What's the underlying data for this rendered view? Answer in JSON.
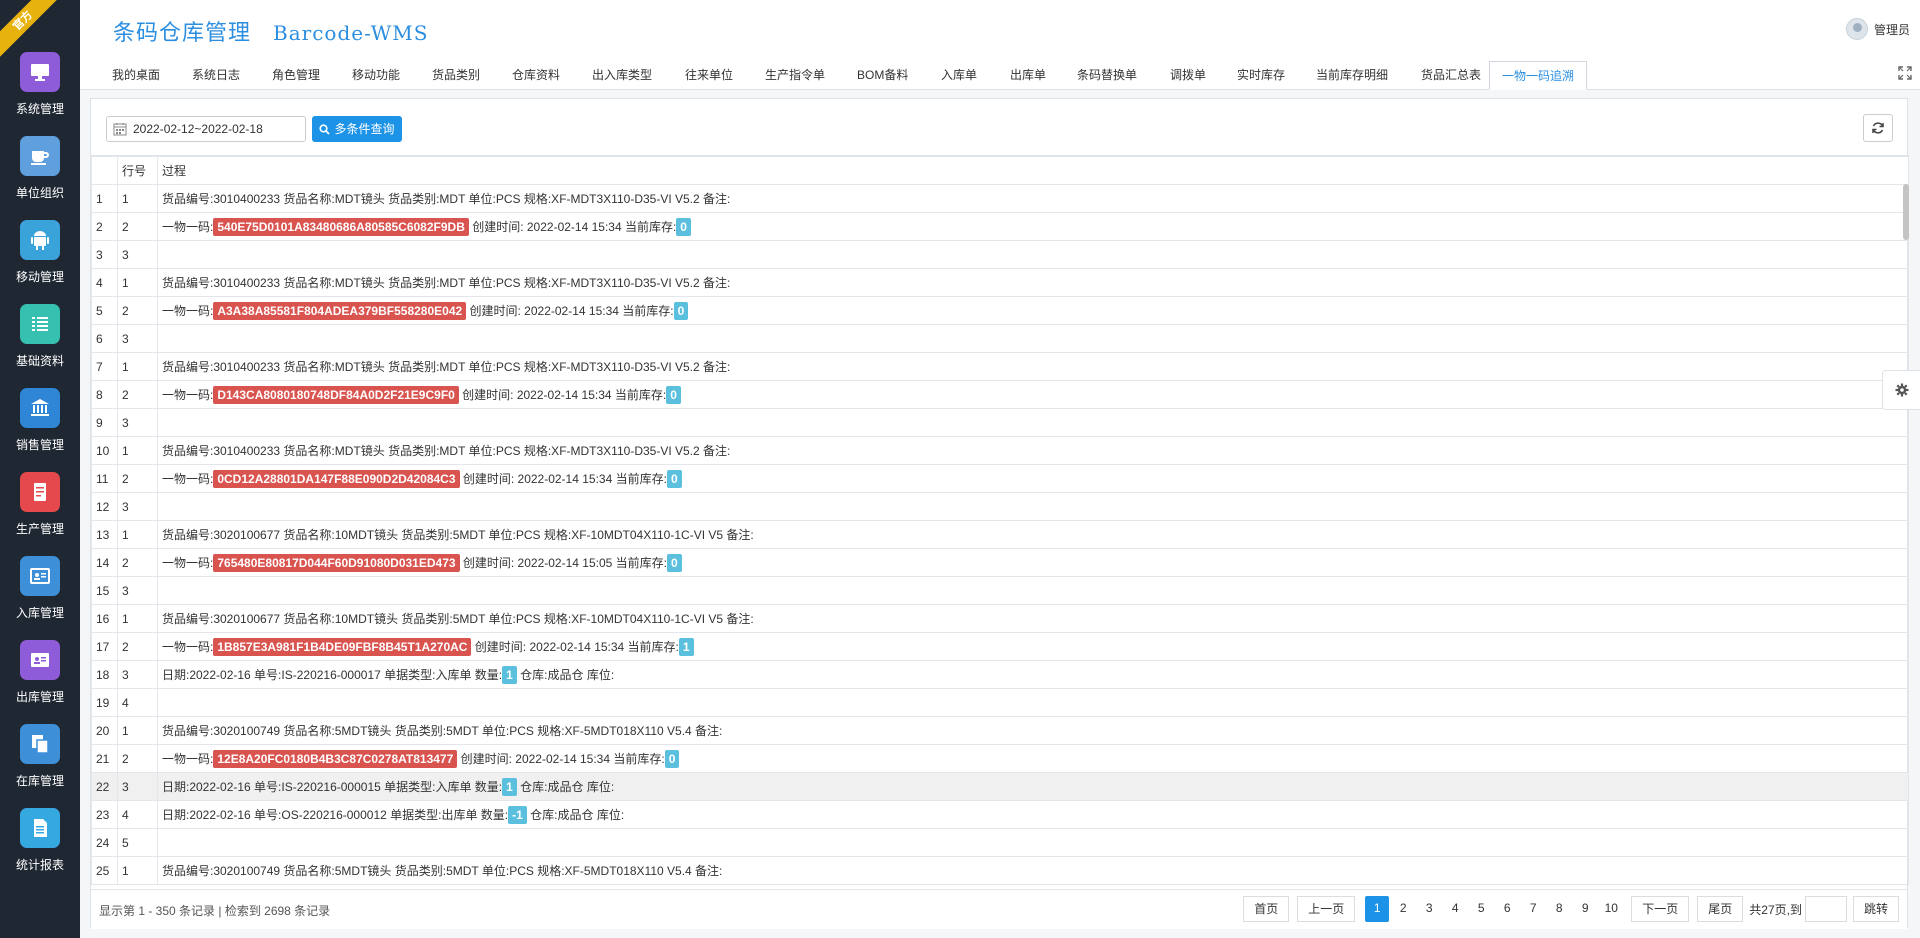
{
  "badge": "官方",
  "app": {
    "title_cn": "条码仓库管理",
    "title_en": "Barcode-WMS",
    "user": "管理员"
  },
  "sidebar": {
    "items": [
      {
        "label": "系统管理",
        "icon": "monitor-icon",
        "color": "#8e5cd9"
      },
      {
        "label": "单位组织",
        "icon": "cup-icon",
        "color": "#5f9fdd"
      },
      {
        "label": "移动管理",
        "icon": "android-icon",
        "color": "#3aa3d9"
      },
      {
        "label": "基础资料",
        "icon": "list-icon",
        "color": "#36c0b0"
      },
      {
        "label": "销售管理",
        "icon": "bank-icon",
        "color": "#2f86d6"
      },
      {
        "label": "生产管理",
        "icon": "document-icon",
        "color": "#e5484d"
      },
      {
        "label": "入库管理",
        "icon": "idcard-icon",
        "color": "#3d8fd8"
      },
      {
        "label": "出库管理",
        "icon": "contact-card-icon",
        "color": "#8e5cd9"
      },
      {
        "label": "在库管理",
        "icon": "copy-icon",
        "color": "#3d8fd8"
      },
      {
        "label": "统计报表",
        "icon": "report-icon",
        "color": "#36a8e0"
      }
    ]
  },
  "tabs": [
    "我的桌面",
    "系统日志",
    "角色管理",
    "移动功能",
    "货品类别",
    "仓库资料",
    "出入库类型",
    "往来单位",
    "生产指令单",
    "BOM备料",
    "入库单",
    "出库单",
    "条码替换单",
    "调拨单",
    "实时库存",
    "当前库存明细",
    "货品汇总表",
    "一物一码追溯"
  ],
  "toolbar": {
    "date_range": "2022-02-12~2022-02-18",
    "query_label": "多条件查询"
  },
  "table": {
    "headers": [
      "",
      "行号",
      "过程"
    ],
    "rows": [
      {
        "n": "1",
        "line": "1",
        "text": "货品编号:3010400233 货品名称:MDT镜头 货品类别:MDT 单位:PCS 规格:XF-MDT3X110-D35-VI V5.2 备注:"
      },
      {
        "n": "2",
        "line": "2",
        "pre": "一物一码:",
        "code": "540E75D0101A83480686A80585C6082F9DB",
        "mid": " 创建时间: 2022-02-14 15:34 当前库存:",
        "badge": "0"
      },
      {
        "n": "3",
        "line": "3",
        "text": ""
      },
      {
        "n": "4",
        "line": "1",
        "text": "货品编号:3010400233 货品名称:MDT镜头 货品类别:MDT 单位:PCS 规格:XF-MDT3X110-D35-VI V5.2 备注:"
      },
      {
        "n": "5",
        "line": "2",
        "pre": "一物一码:",
        "code": "A3A38A85581F804ADEA379BF558280E042",
        "mid": " 创建时间: 2022-02-14 15:34 当前库存:",
        "badge": "0"
      },
      {
        "n": "6",
        "line": "3",
        "text": ""
      },
      {
        "n": "7",
        "line": "1",
        "text": "货品编号:3010400233 货品名称:MDT镜头 货品类别:MDT 单位:PCS 规格:XF-MDT3X110-D35-VI V5.2 备注:"
      },
      {
        "n": "8",
        "line": "2",
        "pre": "一物一码:",
        "code": "D143CA8080180748DF84A0D2F21E9C9F0",
        "mid": " 创建时间: 2022-02-14 15:34 当前库存:",
        "badge": "0"
      },
      {
        "n": "9",
        "line": "3",
        "text": ""
      },
      {
        "n": "10",
        "line": "1",
        "text": "货品编号:3010400233 货品名称:MDT镜头 货品类别:MDT 单位:PCS 规格:XF-MDT3X110-D35-VI V5.2 备注:"
      },
      {
        "n": "11",
        "line": "2",
        "pre": "一物一码:",
        "code": "0CD12A28801DA147F88E090D2D42084C3",
        "mid": " 创建时间: 2022-02-14 15:34 当前库存:",
        "badge": "0"
      },
      {
        "n": "12",
        "line": "3",
        "text": ""
      },
      {
        "n": "13",
        "line": "1",
        "text": "货品编号:3020100677 货品名称:10MDT镜头 货品类别:5MDT 单位:PCS 规格:XF-10MDT04X110-1C-VI V5 备注:"
      },
      {
        "n": "14",
        "line": "2",
        "pre": "一物一码:",
        "code": "765480E80817D044F60D91080D031ED473",
        "mid": " 创建时间: 2022-02-14 15:05 当前库存:",
        "badge": "0"
      },
      {
        "n": "15",
        "line": "3",
        "text": ""
      },
      {
        "n": "16",
        "line": "1",
        "text": "货品编号:3020100677 货品名称:10MDT镜头 货品类别:5MDT 单位:PCS 规格:XF-10MDT04X110-1C-VI V5 备注:"
      },
      {
        "n": "17",
        "line": "2",
        "pre": "一物一码:",
        "code": "1B857E3A981F1B4DE09FBF8B45T1A270AC",
        "mid": " 创建时间: 2022-02-14 15:34 当前库存:",
        "badge": "1"
      },
      {
        "n": "18",
        "line": "3",
        "pre": "日期:2022-02-16 单号:IS-220216-000017 单据类型:入库单 数量:",
        "badge": "1",
        "post": " 仓库:成品仓 库位:"
      },
      {
        "n": "19",
        "line": "4",
        "text": ""
      },
      {
        "n": "20",
        "line": "1",
        "text": "货品编号:3020100749 货品名称:5MDT镜头 货品类别:5MDT 单位:PCS 规格:XF-5MDT018X110 V5.4 备注:"
      },
      {
        "n": "21",
        "line": "2",
        "pre": "一物一码:",
        "code": "12E8A20FC0180B4B3C87C0278AT813477",
        "mid": " 创建时间: 2022-02-14 15:34 当前库存:",
        "badge": "0"
      },
      {
        "n": "22",
        "line": "3",
        "pre": "日期:2022-02-16 单号:IS-220216-000015 单据类型:入库单 数量:",
        "badge": "1",
        "post": " 仓库:成品仓 库位:",
        "hl": true
      },
      {
        "n": "23",
        "line": "4",
        "pre": "日期:2022-02-16 单号:OS-220216-000012 单据类型:出库单 数量:",
        "badge": "-1",
        "post": " 仓库:成品仓 库位:"
      },
      {
        "n": "24",
        "line": "5",
        "text": ""
      },
      {
        "n": "25",
        "line": "1",
        "text": "货品编号:3020100749 货品名称:5MDT镜头 货品类别:5MDT 单位:PCS 规格:XF-5MDT018X110 V5.4 备注:"
      }
    ]
  },
  "footer": {
    "record_info": "显示第 1 - 350 条记录 | 检索到 2698 条记录",
    "first": "首页",
    "prev": "上一页",
    "pages": [
      "1",
      "2",
      "3",
      "4",
      "5",
      "6",
      "7",
      "8",
      "9",
      "10"
    ],
    "current_page": "1",
    "next": "下一页",
    "last": "尾页",
    "total": "共27页,到",
    "go": "跳转"
  }
}
